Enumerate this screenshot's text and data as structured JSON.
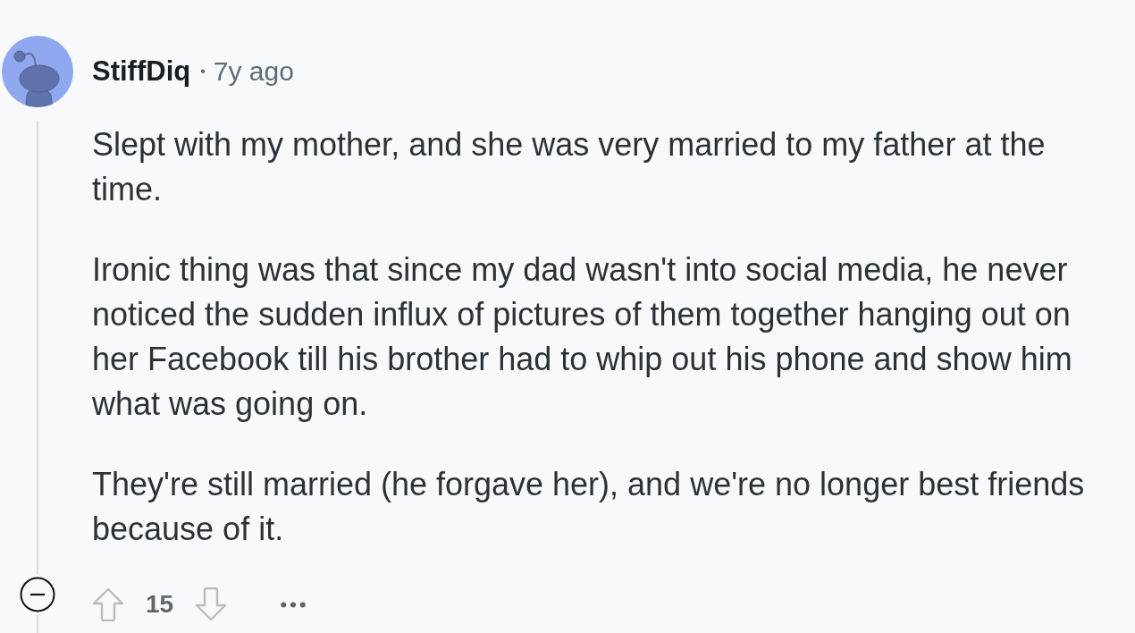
{
  "comment": {
    "author": "StiffDiq",
    "separator": "•",
    "time": "7y ago",
    "paragraphs": [
      "Slept with my mother, and she was very married to my father at the time.",
      "Ironic thing was that since my dad wasn't into social media, he never noticed the sudden influx of pictures of them together hanging out on her Facebook till his brother had to whip out his phone and show him what was going on.",
      "They're still married (he forgave her), and we're no longer best friends because of it."
    ],
    "expanded": true,
    "score": "15"
  }
}
